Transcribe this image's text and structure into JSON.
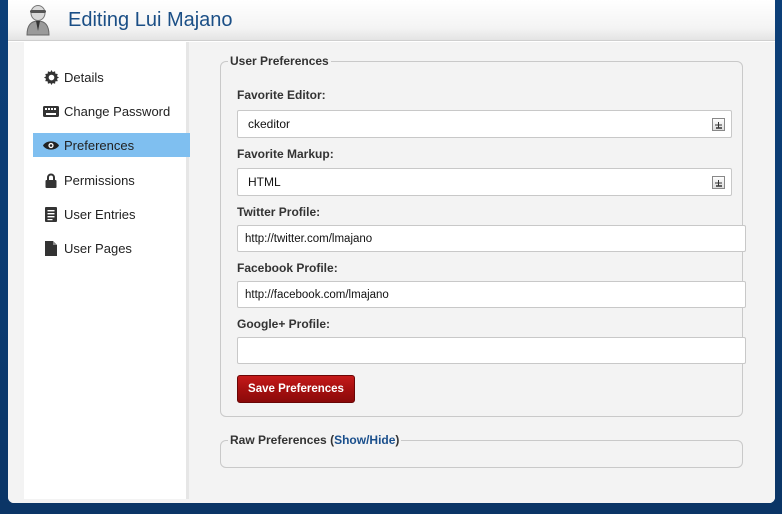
{
  "window": {
    "title": "Editing Lui Majano"
  },
  "sidebar": {
    "items": [
      {
        "label": "Details",
        "icon": "gear-icon"
      },
      {
        "label": "Change Password",
        "icon": "keyboard-icon"
      },
      {
        "label": "Preferences",
        "icon": "eye-icon",
        "active": true
      },
      {
        "label": "Permissions",
        "icon": "lock-icon"
      },
      {
        "label": "User Entries",
        "icon": "document-icon"
      },
      {
        "label": "User Pages",
        "icon": "pages-icon"
      }
    ]
  },
  "preferences": {
    "legend": "User Preferences",
    "favorite_editor": {
      "label": "Favorite Editor:",
      "value": "ckeditor"
    },
    "favorite_markup": {
      "label": "Favorite Markup:",
      "value": "HTML"
    },
    "twitter": {
      "label": "Twitter Profile:",
      "value": "http://twitter.com/lmajano"
    },
    "facebook": {
      "label": "Facebook Profile:",
      "value": "http://facebook.com/lmajano"
    },
    "googleplus": {
      "label": "Google+ Profile:",
      "value": ""
    },
    "save_label": "Save Preferences"
  },
  "raw": {
    "legend": "Raw Preferences",
    "open_paren": "(",
    "toggle_label": "Show/Hide",
    "close_paren": ")"
  },
  "colors": {
    "accent": "#7fbff0",
    "title": "#1b4f86",
    "save_button": "#a30f0f",
    "background": "#0c3f78"
  }
}
